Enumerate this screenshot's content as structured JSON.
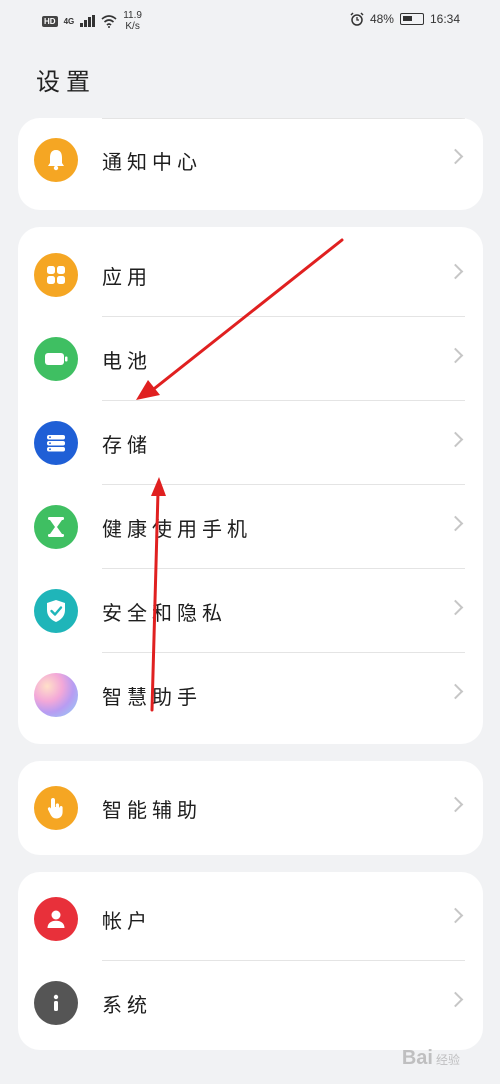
{
  "status_bar": {
    "hd": "HD",
    "network": "4G",
    "speed_value": "11.9",
    "speed_unit": "K/s",
    "battery": "48%",
    "time": "16:34"
  },
  "page": {
    "title": "设置"
  },
  "groups": [
    {
      "items": [
        {
          "label": "通知中心",
          "icon": "bell-icon",
          "color": "#f5a623"
        }
      ]
    },
    {
      "items": [
        {
          "label": "应用",
          "icon": "apps-grid-icon",
          "color": "#f5a623"
        },
        {
          "label": "电池",
          "icon": "battery-icon",
          "color": "#3fbf62"
        },
        {
          "label": "存储",
          "icon": "storage-icon",
          "color": "#1f5fd6"
        },
        {
          "label": "健康使用手机",
          "icon": "hourglass-icon",
          "color": "#3fbf62"
        },
        {
          "label": "安全和隐私",
          "icon": "shield-check-icon",
          "color": "#1fb5b9"
        },
        {
          "label": "智慧助手",
          "icon": "assistant-orb-icon",
          "color": "#c9a3f2"
        }
      ]
    },
    {
      "items": [
        {
          "label": "智能辅助",
          "icon": "hand-pointer-icon",
          "color": "#f5a623"
        }
      ]
    },
    {
      "items": [
        {
          "label": "帐户",
          "icon": "user-icon",
          "color": "#e8303a"
        },
        {
          "label": "系统",
          "icon": "info-icon",
          "color": "#555555"
        }
      ]
    }
  ],
  "annotation_color": "#e02020",
  "watermark": {
    "brand": "Bai",
    "suffix": "经验"
  }
}
